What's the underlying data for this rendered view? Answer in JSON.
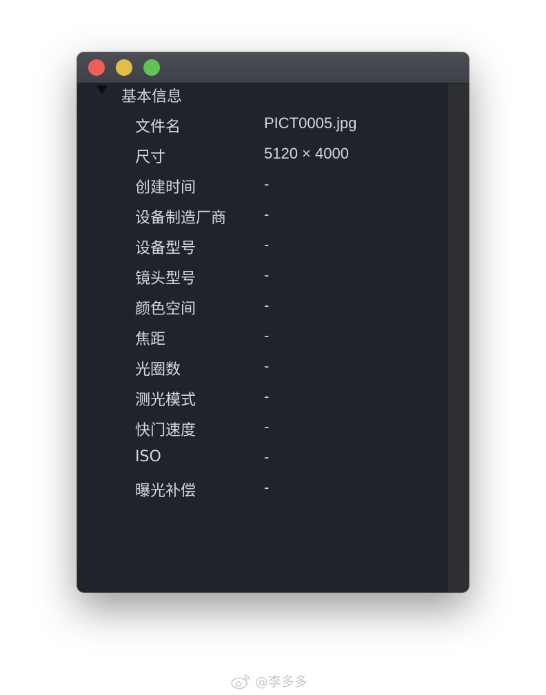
{
  "section": {
    "title": "基本信息"
  },
  "rows": [
    {
      "key": "文件名",
      "value": "PICT0005.jpg"
    },
    {
      "key": "尺寸",
      "value": "5120 × 4000"
    },
    {
      "key": "创建时间",
      "value": "-"
    },
    {
      "key": "设备制造厂商",
      "value": "-"
    },
    {
      "key": "设备型号",
      "value": "-"
    },
    {
      "key": "镜头型号",
      "value": "-"
    },
    {
      "key": "颜色空间",
      "value": "-"
    },
    {
      "key": "焦距",
      "value": "-"
    },
    {
      "key": "光圈数",
      "value": "-"
    },
    {
      "key": "测光模式",
      "value": "-"
    },
    {
      "key": "快门速度",
      "value": "-"
    },
    {
      "key": "ISO",
      "value": "-"
    },
    {
      "key": "曝光补偿",
      "value": "-"
    }
  ],
  "watermark": {
    "text": "@李多多"
  }
}
